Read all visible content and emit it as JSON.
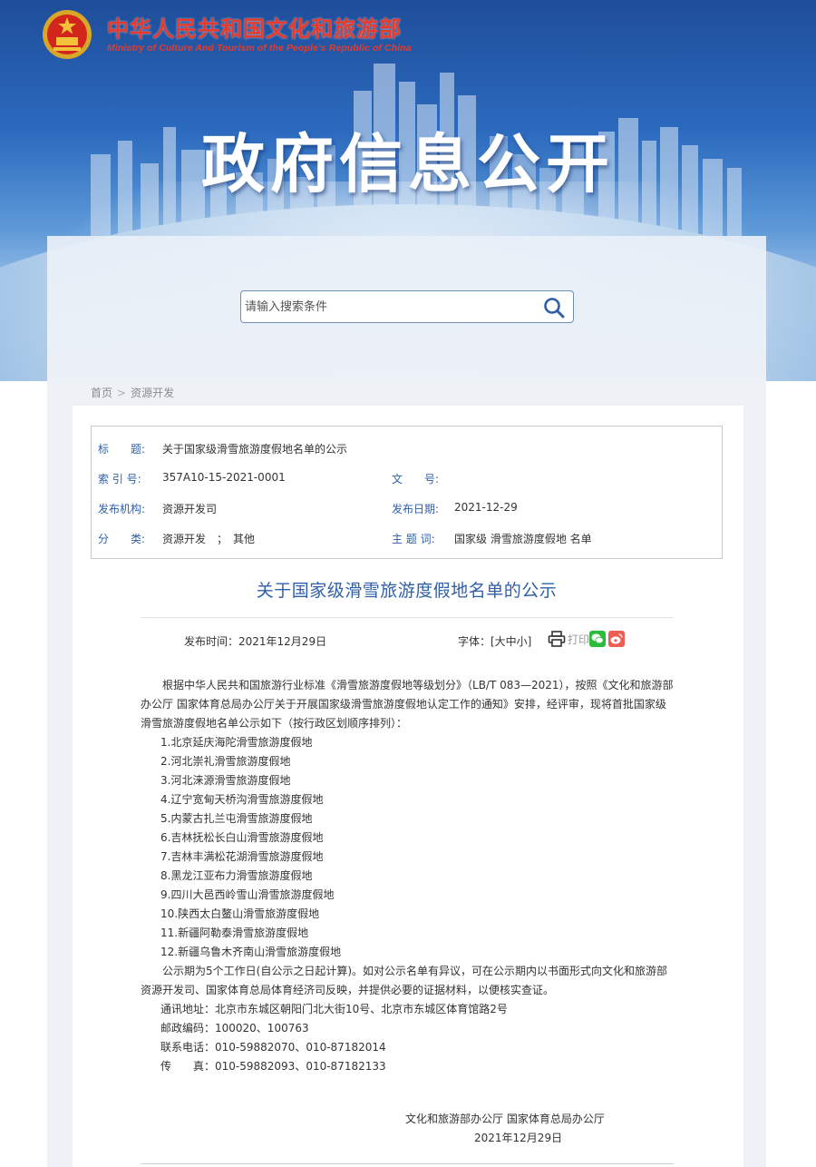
{
  "header": {
    "site_name": "中华人民共和国文化和旅游部",
    "site_name_en": "Ministry of Culture And Tourism of the People’s Republic of China",
    "banner_title": "政府信息公开"
  },
  "search": {
    "placeholder": "请输入搜索条件",
    "icon": "search-icon"
  },
  "breadcrumb": {
    "items": [
      "首页",
      "资源开发"
    ],
    "separator": ">"
  },
  "meta": {
    "title_label": "标　　题:",
    "title_value": "关于国家级滑雪旅游度假地名单的公示",
    "index_label": "索 引 号:",
    "index_value": "357A10-15-2021-0001",
    "doc_no_label": "文　　号:",
    "doc_no_value": "",
    "issuer_label": "发布机构:",
    "issuer_value": "资源开发司",
    "date_label": "发布日期:",
    "date_value": "2021-12-29",
    "category_label": "分　　类:",
    "category_value": "资源开发　；　其他",
    "topic_label": "主 题 词:",
    "topic_value": "国家级 滑雪旅游度假地 名单"
  },
  "article": {
    "title": "关于国家级滑雪旅游度假地名单的公示",
    "publish_time": "发布时间：2021年12月29日",
    "font_size": "字体：[大中小]",
    "print_label": "打印",
    "intro": "根据中华人民共和国旅游行业标准《滑雪旅游度假地等级划分》（LB/T 083—2021），按照《文化和旅游部办公厅 国家体育总局办公厅关于开展国家级滑雪旅游度假地认定工作的通知》安排，经评审，现将首批国家级滑雪旅游度假地名单公示如下（按行政区划顺序排列）：",
    "list": [
      "1.北京延庆海陀滑雪旅游度假地",
      "2.河北崇礼滑雪旅游度假地",
      "3.河北涞源滑雪旅游度假地",
      "4.辽宁宽甸天桥沟滑雪旅游度假地",
      "5.内蒙古扎兰屯滑雪旅游度假地",
      "6.吉林抚松长白山滑雪旅游度假地",
      "7.吉林丰满松花湖滑雪旅游度假地",
      "8.黑龙江亚布力滑雪旅游度假地",
      "9.四川大邑西岭雪山滑雪旅游度假地",
      "10.陕西太白鳌山滑雪旅游度假地",
      "11.新疆阿勒泰滑雪旅游度假地",
      "12.新疆乌鲁木齐南山滑雪旅游度假地"
    ],
    "notice": "公示期为5个工作日(自公示之日起计算)。如对公示名单有异议，可在公示期内以书面形式向文化和旅游部资源开发司、国家体育总局体育经济司反映，并提供必要的证据材料，以便核实查证。",
    "address": "通讯地址：北京市东城区朝阳门北大街10号、北京市东城区体育馆路2号",
    "postcode": "邮政编码：100020、100763",
    "phone": "联系电话：010-59882070、010-87182014",
    "fax": "传　　真：010-59882093、010-87182133",
    "signature": "文化和旅游部办公厅 国家体育总局办公厅",
    "sign_date": "2021年12月29日"
  },
  "colors": {
    "brand_red": "#e43b2c",
    "label_blue": "#2f5fa8",
    "wechat_green": "#2dbb3c",
    "weibo_red": "#ee5d52"
  }
}
